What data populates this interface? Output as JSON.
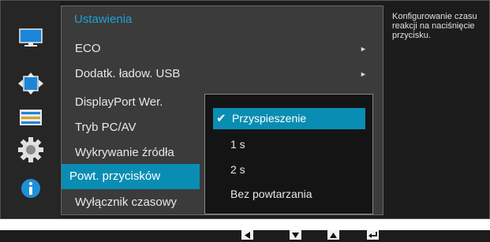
{
  "menu": {
    "title": "Ustawienia",
    "items": [
      {
        "label": "ECO",
        "arrow": "►"
      },
      {
        "label": "Dodatk. ładow. USB",
        "arrow": "►"
      },
      {
        "label": "DisplayPort Wer.",
        "arrow": ""
      },
      {
        "label": "Tryb PC/AV",
        "arrow": ""
      },
      {
        "label": "Wykrywanie źródła",
        "arrow": ""
      },
      {
        "label": "Powt. przycisków",
        "arrow": ""
      },
      {
        "label": "Wyłącznik czasowy",
        "arrow": ""
      }
    ],
    "selected_index": 5
  },
  "submenu": {
    "options": [
      {
        "label": "Przyspieszenie",
        "checked": true
      },
      {
        "label": "1 s",
        "checked": false
      },
      {
        "label": "2 s",
        "checked": false
      },
      {
        "label": "Bez powtarzania",
        "checked": false
      }
    ],
    "check_mark": "✔"
  },
  "description": "Konfigurowanie czasu reakcji na naciśnięcie przycisku.",
  "side_icons": [
    "monitor-icon",
    "resize-arrows-icon",
    "settings-list-icon",
    "gear-icon",
    "info-icon"
  ],
  "nav_keys": [
    "left-arrow-key-icon",
    "down-arrow-key-icon",
    "up-arrow-key-icon",
    "enter-key-icon"
  ],
  "colors": {
    "accent": "#0a8db3",
    "title": "#1ba3d6",
    "info_icon": "#1e90d8"
  }
}
